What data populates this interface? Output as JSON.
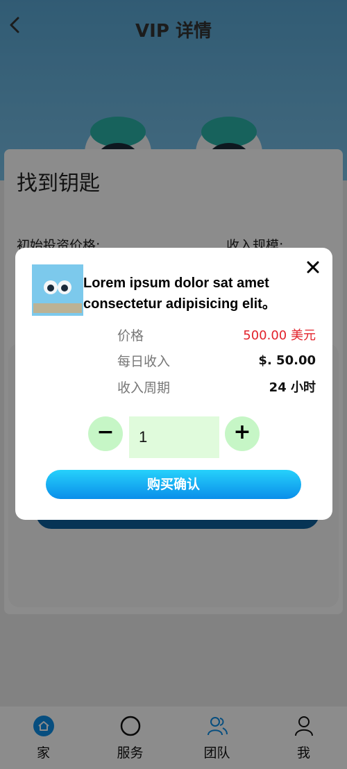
{
  "header": {
    "title": "VIP 详情"
  },
  "detail": {
    "title": "找到钥匙",
    "initial_price_label": "初始投资价格:",
    "income_scale_label": "收入规模:"
  },
  "modal": {
    "description": "Lorem ipsum dolor sat amet consectetur adipisicing elit。",
    "rows": [
      {
        "label": "价格",
        "value": "500.00 美元"
      },
      {
        "label": "每日收入",
        "value": "$. 50.00"
      },
      {
        "label": "收入周期",
        "value": "24 小时"
      }
    ],
    "quantity": "1",
    "minus_label": "−",
    "plus_label": "+",
    "confirm_label": "购买确认"
  },
  "nav": [
    {
      "label": "家",
      "icon": "home-icon"
    },
    {
      "label": "服务",
      "icon": "circle-icon"
    },
    {
      "label": "团队",
      "icon": "team-icon"
    },
    {
      "label": "我",
      "icon": "user-icon"
    }
  ],
  "colors": {
    "accent": "#0d8fe8",
    "price": "#e2222b",
    "stepper": "#c6f6c6",
    "header_bg": "#5aa7d4"
  }
}
